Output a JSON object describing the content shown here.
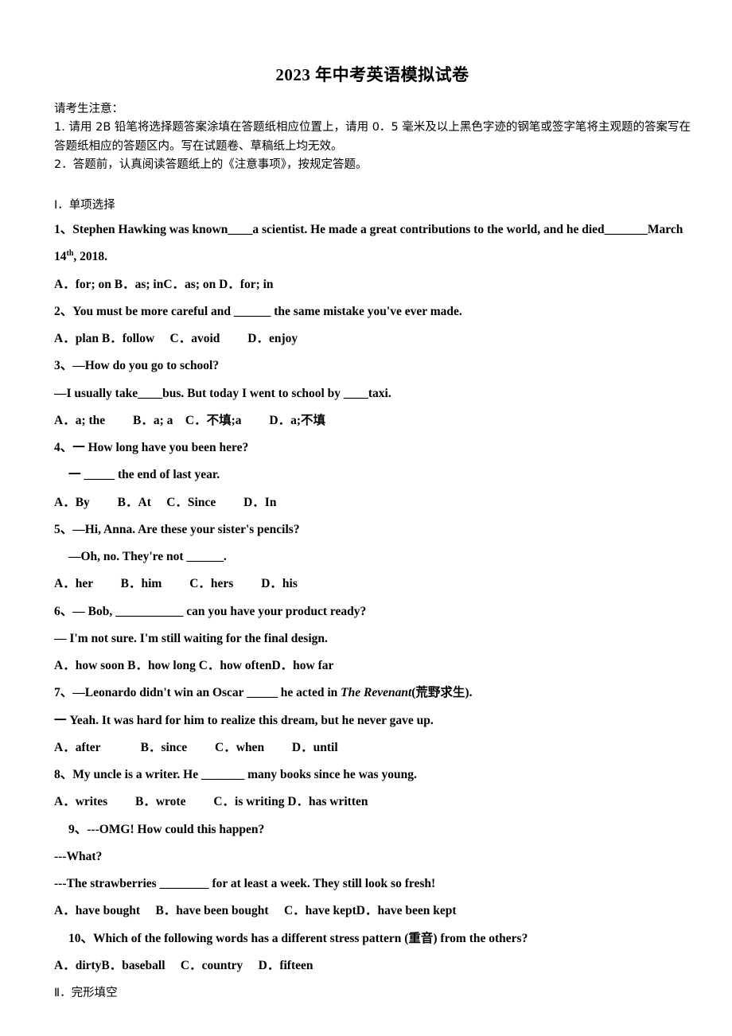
{
  "title": "2023 年中考英语模拟试卷",
  "notice": {
    "heading": "请考生注意：",
    "line1": "1. 请用 2B 铅笔将选择题答案涂填在答题纸相应位置上，请用 0．5 毫米及以上黑色字迹的钢笔或签字笔将主观题的答案写在答题纸相应的答题区内。写在试题卷、草稿纸上均无效。",
    "line2": "2．答题前，认真阅读答题纸上的《注意事项》，按规定答题。"
  },
  "sections": {
    "one": "Ⅰ．单项选择",
    "two": "Ⅱ．完形填空"
  },
  "questions": [
    {
      "stem_a": "1、Stephen Hawking was known____a scientist. He made a great contributions to the world, and he died_______March",
      "stem_b_pre": "14",
      "stem_b_sup": "th",
      "stem_b_post": ", 2018.",
      "options": "A．for; on    B．as; inC．as; on    D．for; in"
    },
    {
      "stem_a": "2、You must be more careful and ______ the same mistake you've ever made.",
      "options": "A．plan B．follow　 C．avoid　　 D．enjoy"
    },
    {
      "stem_a": "3、—How do you go to school?",
      "stem_b": "—I usually take____bus. But today I went to school by        ____taxi.",
      "options": "A．a; the　　 B．a; a　C．不填;a　　 D．a;不填"
    },
    {
      "stem_a": "4、一 How long have you been here?",
      "stem_b": "一 _____  the end of last year.",
      "options": "A．By　　 B．At　 C．Since　　 D．In"
    },
    {
      "stem_a": "5、—Hi, Anna. Are these your sister's pencils?",
      "stem_b": "—Oh, no. They're not ______.",
      "options": "A．her　　 B．him　　 C．hers　　 D．his"
    },
    {
      "stem_a": "6、— Bob, ___________ can you have your product ready?",
      "stem_b": "— I'm not sure. I'm still waiting for the final design.",
      "options": "A．how soon B．how long C．how oftenD．how far"
    },
    {
      "stem_a": "7、—Leonardo didn't win an Oscar _____  he acted in ",
      "stem_a_ital": "The Revenant",
      "stem_a_tail": "(荒野求生).",
      "stem_b": "一 Yeah. It was hard for him to realize this dream, but he never gave up.",
      "options": "A．after　　　 B．since　　 C．when　　 D．until"
    },
    {
      "stem_a": "8、My uncle is a writer. He _______ many books since he was young.",
      "options": "A．writes　　 B．wrote　　 C．is writing D．has written"
    },
    {
      "stem_a": "9、---OMG! How could this happen?",
      "stem_b": "---What?",
      "stem_c": "---The strawberries ________ for at least a week. They still look so fresh!",
      "options": "A．have bought　 B．have been bought　 C．have keptD．have been kept"
    },
    {
      "stem_a": "10、Which of the following words has a different stress pattern (重音) from the others?",
      "options": "A．dirtyB．baseball　 C．country　 D．fifteen"
    }
  ]
}
